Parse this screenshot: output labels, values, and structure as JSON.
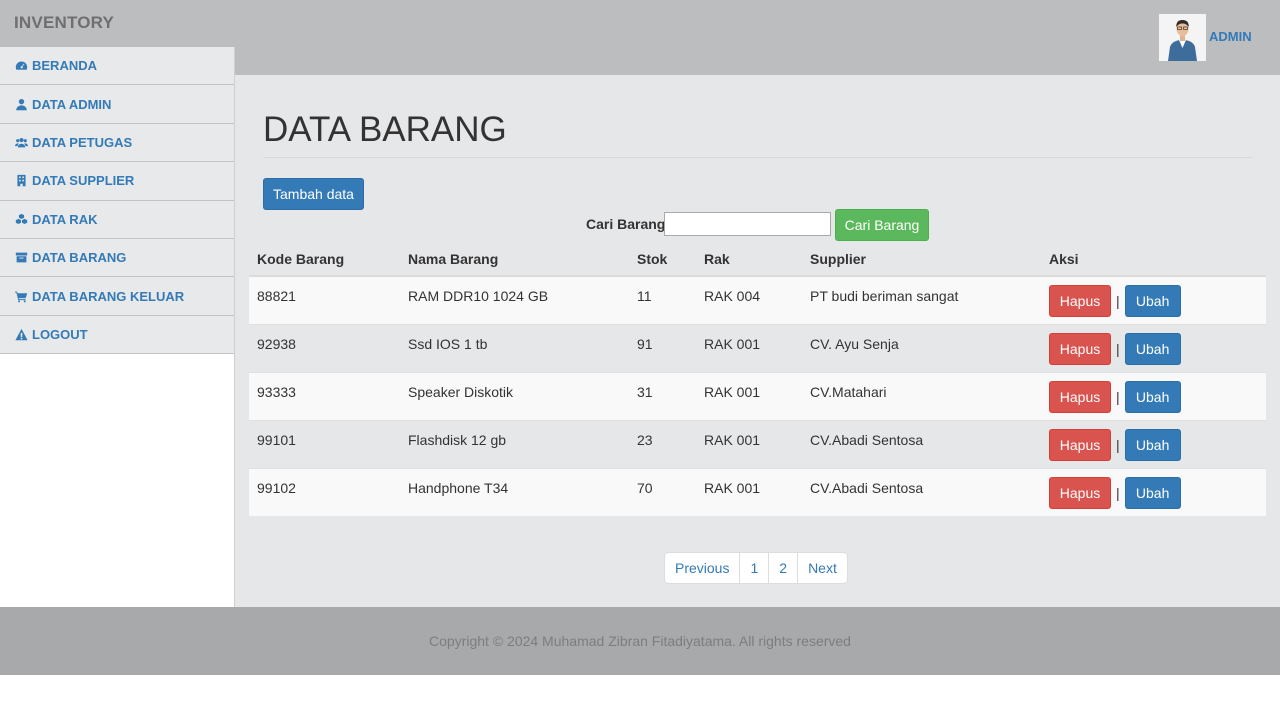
{
  "header": {
    "brand": "INVENTORY",
    "user_label": "ADMIN"
  },
  "sidebar": {
    "items": [
      {
        "label": "BERANDA",
        "icon": "dashboard-icon"
      },
      {
        "label": "DATA ADMIN",
        "icon": "user-icon"
      },
      {
        "label": "DATA PETUGAS",
        "icon": "users-icon"
      },
      {
        "label": "DATA SUPPLIER",
        "icon": "building-icon"
      },
      {
        "label": "DATA RAK",
        "icon": "cubes-icon"
      },
      {
        "label": "DATA BARANG",
        "icon": "archive-icon"
      },
      {
        "label": "DATA BARANG KELUAR",
        "icon": "cart-icon"
      },
      {
        "label": "LOGOUT",
        "icon": "warning-icon"
      }
    ]
  },
  "main": {
    "title": "DATA BARANG",
    "add_button": "Tambah data",
    "search": {
      "label": "Cari Barang",
      "value": "",
      "button": "Cari Barang"
    },
    "table": {
      "headers": [
        "Kode Barang",
        "Nama Barang",
        "Stok",
        "Rak",
        "Supplier",
        "Aksi"
      ],
      "rows": [
        [
          "88821",
          "RAM DDR10 1024 GB",
          "11",
          "RAK 004",
          "PT budi beriman sangat"
        ],
        [
          "92938",
          "Ssd IOS 1 tb",
          "91",
          "RAK 001",
          "CV. Ayu Senja"
        ],
        [
          "93333",
          "Speaker Diskotik",
          "31",
          "RAK 001",
          "CV.Matahari"
        ],
        [
          "99101",
          "Flashdisk 12 gb",
          "23",
          "RAK 001",
          "CV.Abadi Sentosa"
        ],
        [
          "99102",
          "Handphone T34",
          "70",
          "RAK 001",
          "CV.Abadi Sentosa"
        ]
      ],
      "delete_label": "Hapus",
      "separator": "|",
      "edit_label": "Ubah"
    },
    "pagination": {
      "previous": "Previous",
      "pages": [
        "1",
        "2"
      ],
      "next": "Next"
    }
  },
  "footer": {
    "text": "Copyright © 2024 Muhamad Zibran Fitadiyatama. All rights reserved"
  },
  "colors": {
    "primary": "#337ab7",
    "success": "#5cb85c",
    "danger": "#d9534f",
    "topbar": "#bcbdbf",
    "footer": "#a8a9ab"
  }
}
